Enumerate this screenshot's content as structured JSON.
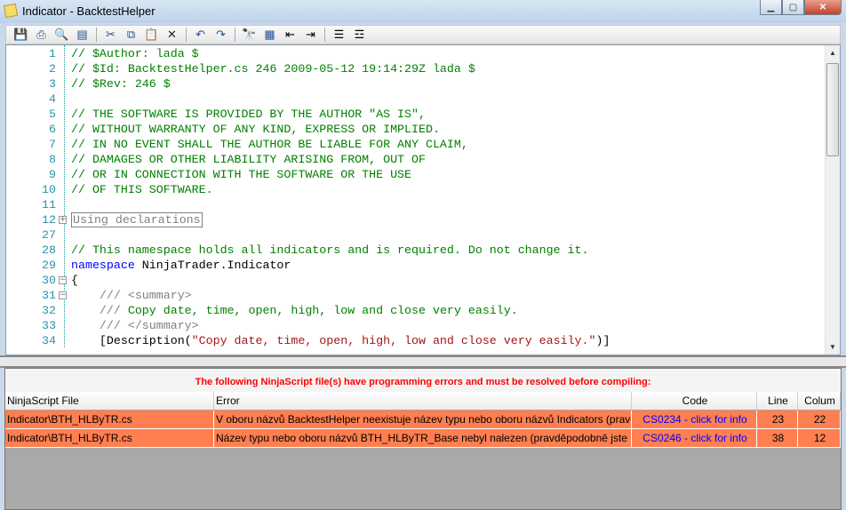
{
  "window": {
    "title": "Indicator - BacktestHelper"
  },
  "toolbar": {
    "icons": [
      "save-icon",
      "print-icon",
      "print-preview-icon",
      "page-setup-icon",
      "cut-icon",
      "copy-icon",
      "paste-icon",
      "delete-icon",
      "undo-icon",
      "redo-icon",
      "find-icon",
      "select-all-icon",
      "outdent-icon",
      "indent-icon",
      "comment-icon",
      "uncomment-icon"
    ]
  },
  "editor": {
    "lines": [
      {
        "n": "1",
        "t": [
          [
            "// $Author: lada $",
            "c"
          ]
        ]
      },
      {
        "n": "2",
        "t": [
          [
            "// $Id: BacktestHelper.cs 246 2009-05-12 19:14:29Z lada $",
            "c"
          ]
        ]
      },
      {
        "n": "3",
        "t": [
          [
            "// $Rev: 246 $",
            "c"
          ]
        ]
      },
      {
        "n": "4",
        "t": []
      },
      {
        "n": "5",
        "t": [
          [
            "// THE SOFTWARE IS PROVIDED BY THE AUTHOR \"AS IS\",",
            "c"
          ]
        ]
      },
      {
        "n": "6",
        "t": [
          [
            "// WITHOUT WARRANTY OF ANY KIND, EXPRESS OR IMPLIED.",
            "c"
          ]
        ]
      },
      {
        "n": "7",
        "t": [
          [
            "// IN NO EVENT SHALL THE AUTHOR BE LIABLE FOR ANY CLAIM,",
            "c"
          ]
        ]
      },
      {
        "n": "8",
        "t": [
          [
            "// DAMAGES OR OTHER LIABILITY ARISING FROM, OUT OF",
            "c"
          ]
        ]
      },
      {
        "n": "9",
        "t": [
          [
            "// OR IN CONNECTION WITH THE SOFTWARE OR THE USE",
            "c"
          ]
        ]
      },
      {
        "n": "10",
        "t": [
          [
            "// OF THIS SOFTWARE.",
            "c"
          ]
        ]
      },
      {
        "n": "11",
        "t": []
      },
      {
        "n": "12",
        "fold": "+",
        "t": [
          [
            "Using declarations",
            "box"
          ]
        ]
      },
      {
        "n": "27",
        "t": []
      },
      {
        "n": "28",
        "t": [
          [
            "// This namespace holds all indicators and is required. Do not change it.",
            "c"
          ]
        ]
      },
      {
        "n": "29",
        "t": [
          [
            "namespace",
            "k"
          ],
          [
            " NinjaTrader.Indicator",
            "p"
          ]
        ]
      },
      {
        "n": "30",
        "fold": "-",
        "t": [
          [
            "{",
            "p"
          ]
        ]
      },
      {
        "n": "31",
        "fold": "-",
        "t": [
          [
            "    /// ",
            "d"
          ],
          [
            "<summary>",
            "d"
          ]
        ]
      },
      {
        "n": "32",
        "t": [
          [
            "    /// ",
            "d"
          ],
          [
            "Copy date, time, open, high, low and close very easily.",
            "c"
          ]
        ]
      },
      {
        "n": "33",
        "t": [
          [
            "    /// </summary>",
            "d"
          ]
        ]
      },
      {
        "n": "34",
        "t": [
          [
            "    [Description(",
            "p"
          ],
          [
            "\"Copy date, time, open, high, low and close very easily.\"",
            "s"
          ],
          [
            ")]",
            "p"
          ]
        ]
      }
    ]
  },
  "errors": {
    "message": "The following NinjaScript file(s) have programming errors and must be resolved before compiling:",
    "columns": [
      "NinjaScript File",
      "Error",
      "Code",
      "Line",
      "Colum"
    ],
    "rows": [
      {
        "file": "Indicator\\BTH_HLByTR.cs",
        "error": "V oboru názvů BacktestHelper neexistuje název typu nebo oboru názvů Indicators (pravděpo",
        "code": "CS0234 - click for info",
        "line": "23",
        "column": "22"
      },
      {
        "file": "Indicator\\BTH_HLByTR.cs",
        "error": "Název typu nebo oboru názvů BTH_HLByTR_Base nebyl nalezen (pravděpodobně jste neuv",
        "code": "CS0246 - click for info",
        "line": "38",
        "column": "12"
      }
    ],
    "row_color": "#ff7f50",
    "message_color": "#ff0000",
    "link_color": "#0000ff"
  }
}
